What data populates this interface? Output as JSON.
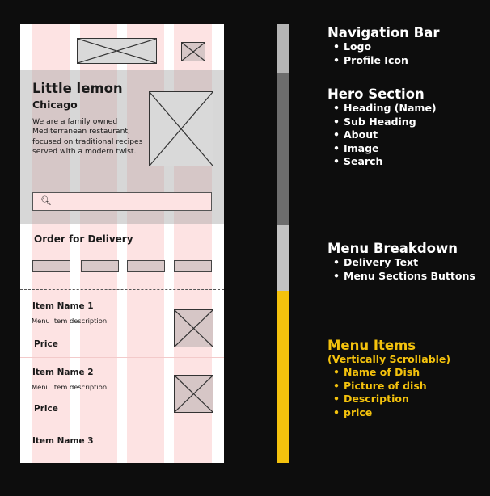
{
  "colors": {
    "background": "#0d0d0d",
    "grid_column": "#fde3e3",
    "bar_nav": "#b5b5b5",
    "bar_hero": "#6d6d6d",
    "bar_menu": "#c3c3c3",
    "bar_items": "#f4c20d",
    "highlight": "#f4c20d"
  },
  "wireframe": {
    "hero": {
      "title": "Little lemon",
      "subtitle": "Chicago",
      "about": "We are a family owned Mediterranean restaurant, focused on traditional recipes served with a modern twist."
    },
    "search_icon": "search-icon",
    "delivery_text": "Order for Delivery",
    "items": [
      {
        "name": "Item Name 1",
        "description": "Menu Item description",
        "price": "Price"
      },
      {
        "name": "Item Name 2",
        "description": "Menu Item description",
        "price": "Price"
      },
      {
        "name": "Item Name 3"
      }
    ]
  },
  "legend": {
    "nav": {
      "title": "Navigation Bar",
      "items": [
        "Logo",
        "Profile Icon"
      ]
    },
    "hero": {
      "title": "Hero Section",
      "items": [
        "Heading (Name)",
        "Sub Heading",
        "About",
        "Image",
        "Search"
      ]
    },
    "menu": {
      "title": "Menu Breakdown",
      "items": [
        "Delivery Text",
        "Menu Sections Buttons"
      ]
    },
    "items": {
      "title": "Menu Items",
      "subtitle": "(Vertically Scrollable)",
      "items": [
        "Name of Dish",
        "Picture of dish",
        "Description",
        "price"
      ]
    }
  }
}
